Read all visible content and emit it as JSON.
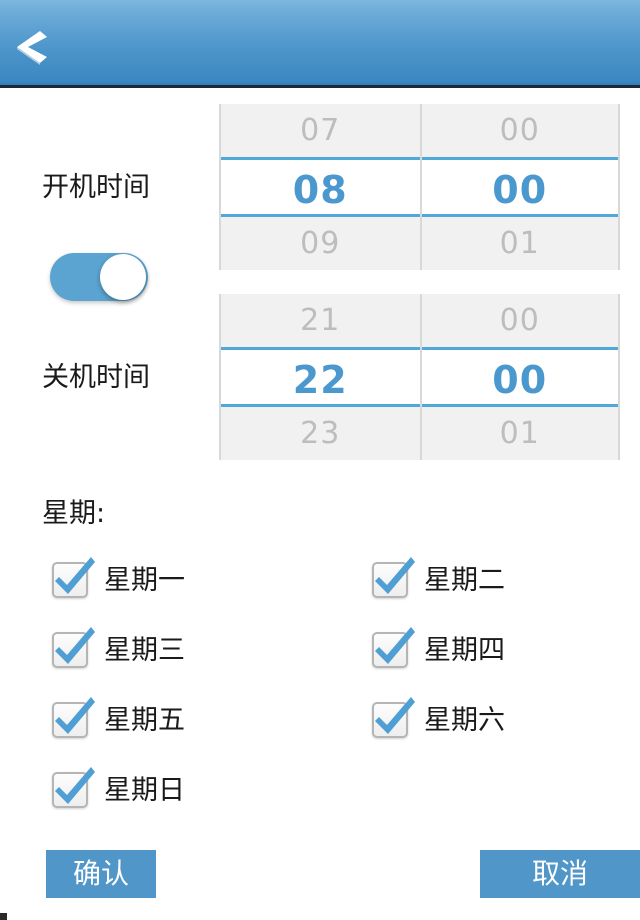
{
  "header": {
    "back_icon": "back-chevron-icon"
  },
  "power_on": {
    "label": "开机时间",
    "enabled": true,
    "hour": {
      "prev": "07",
      "selected": "08",
      "next": "09"
    },
    "minute": {
      "prev": "00",
      "selected": "00",
      "next": "01"
    }
  },
  "power_off": {
    "label": "关机时间",
    "hour": {
      "prev": "21",
      "selected": "22",
      "next": "23"
    },
    "minute": {
      "prev": "00",
      "selected": "00",
      "next": "01"
    }
  },
  "weekdays": {
    "title": "星期:",
    "items": [
      {
        "label": "星期一",
        "checked": true
      },
      {
        "label": "星期二",
        "checked": true
      },
      {
        "label": "星期三",
        "checked": true
      },
      {
        "label": "星期四",
        "checked": true
      },
      {
        "label": "星期五",
        "checked": true
      },
      {
        "label": "星期六",
        "checked": true
      },
      {
        "label": "星期日",
        "checked": true
      }
    ]
  },
  "footer": {
    "confirm_label": "确认",
    "cancel_label": "取消"
  },
  "colors": {
    "header_top": "#7cb7dd",
    "header_bottom": "#3b87c2",
    "accent": "#4a98ce",
    "picker_line": "#4fa8d8",
    "toggle_on": "#5ba3d0",
    "button": "#5096c8",
    "inactive_text": "#bdbdbd"
  }
}
